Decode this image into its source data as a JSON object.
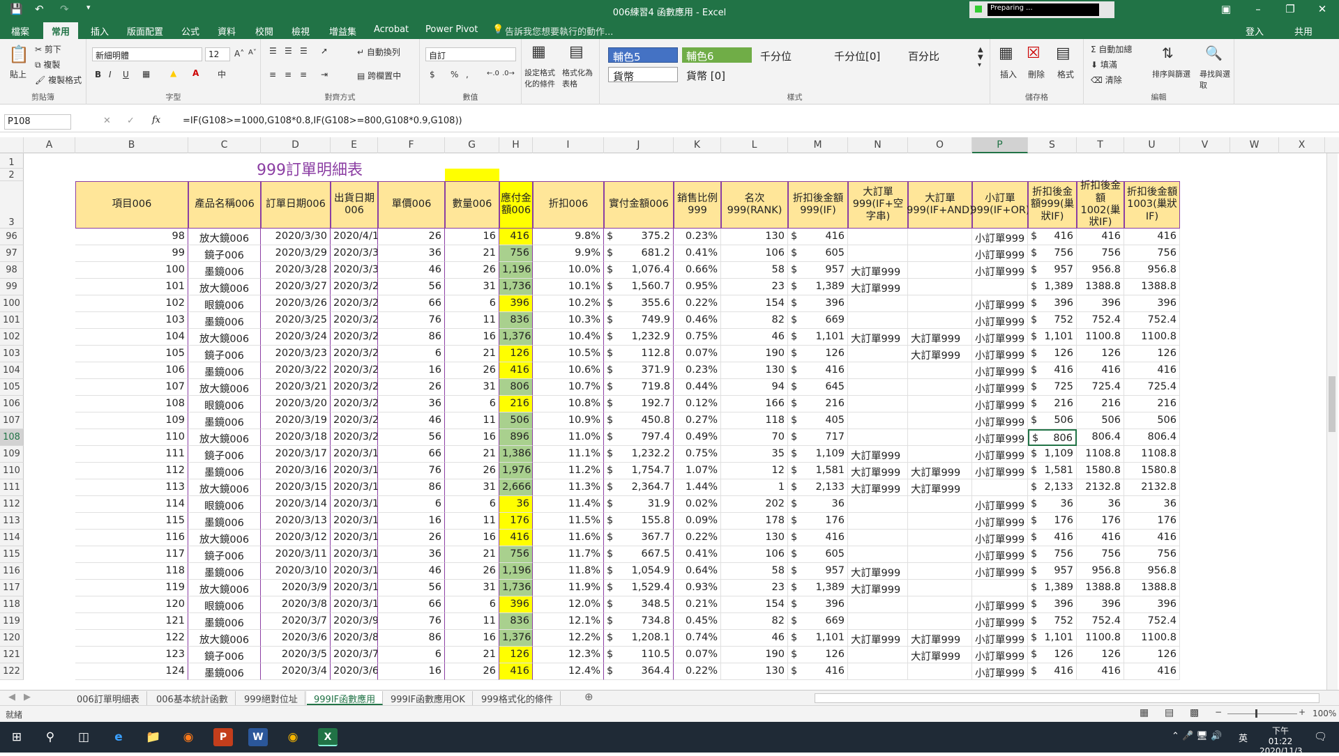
{
  "window_title": "006練習4 函數應用 - Excel",
  "preparing_text": "Preparing ...",
  "ribbon_tabs": [
    "檔案",
    "常用",
    "插入",
    "版面配置",
    "公式",
    "資料",
    "校閱",
    "檢視",
    "增益集",
    "Acrobat",
    "Power Pivot"
  ],
  "tell_me": "告訴我您想要執行的動作...",
  "signin": "登入",
  "share": "共用",
  "clipboard": {
    "paste": "貼上",
    "cut": "剪下",
    "copy": "複製",
    "format_painter": "複製格式",
    "label": "剪貼簿"
  },
  "font": {
    "name": "新細明體",
    "size": "12",
    "label": "字型",
    "bold": "B",
    "italic": "I",
    "underline": "U"
  },
  "alignment": {
    "wrap": "自動換列",
    "merge": "跨欄置中",
    "label": "對齊方式"
  },
  "number": {
    "format": "自訂",
    "label": "數值",
    "currency": "$",
    "percent": "%",
    "comma": ","
  },
  "conditional": {
    "cond_format": "設定格式化的條件",
    "format_table": "格式化為表格"
  },
  "styles": {
    "label": "樣式",
    "items": [
      "輔色5",
      "輔色6",
      "千分位",
      "千分位[0]",
      "百分比",
      "貨幣",
      "貨幣 [0]"
    ]
  },
  "cells": {
    "insert": "插入",
    "delete": "刪除",
    "format": "格式",
    "label": "儲存格"
  },
  "editing": {
    "autosum": "自動加總",
    "fill": "填滿",
    "clear": "清除",
    "sort": "排序與篩選",
    "find": "尋找與選取",
    "label": "編輯"
  },
  "name_box": "P108",
  "formula": "=IF(G108>=1000,G108*0.8,IF(G108>=800,G108*0.9,G108))",
  "columns": [
    "A",
    "B",
    "C",
    "D",
    "E",
    "F",
    "G",
    "H",
    "I",
    "J",
    "K",
    "L",
    "M",
    "N",
    "O",
    "P",
    "S",
    "T",
    "U",
    "V",
    "W",
    "X"
  ],
  "sheet_title": "999訂單明細表",
  "headers": [
    "項目006",
    "產品名稱006",
    "訂單日期006",
    "出貨日期006",
    "單價006",
    "數量006",
    "應付金額006",
    "折扣006",
    "實付金額006",
    "銷售比例999",
    "名次999(RANK)",
    "折扣後金額999(IF)",
    "大訂單999(IF+空字串)",
    "大訂單999(IF+AND)",
    "小訂單999(IF+OR)",
    "折扣後金額999(巢狀IF)",
    "折扣後金額1002(巢狀IF)",
    "折扣後金額1003(巢狀IF)"
  ],
  "rows": [
    [
      "96",
      "98",
      "放大鏡006",
      "2020/3/30",
      "2020/4/1",
      "26",
      "16",
      "416",
      "9.8%",
      "375.2",
      "0.23%",
      "130",
      "416",
      "",
      "",
      "小訂單999",
      "416",
      "416",
      "416"
    ],
    [
      "97",
      "99",
      "鏡子006",
      "2020/3/29",
      "2020/3/31",
      "36",
      "21",
      "756",
      "9.9%",
      "681.2",
      "0.41%",
      "106",
      "605",
      "",
      "",
      "小訂單999",
      "756",
      "756",
      "756"
    ],
    [
      "98",
      "100",
      "墨鏡006",
      "2020/3/28",
      "2020/3/30",
      "46",
      "26",
      "1,196",
      "10.0%",
      "1,076.4",
      "0.66%",
      "58",
      "957",
      "大訂單999",
      "",
      "小訂單999",
      "957",
      "956.8",
      "956.8"
    ],
    [
      "99",
      "101",
      "放大鏡006",
      "2020/3/27",
      "2020/3/29",
      "56",
      "31",
      "1,736",
      "10.1%",
      "1,560.7",
      "0.95%",
      "23",
      "1,389",
      "大訂單999",
      "",
      "",
      "1,389",
      "1388.8",
      "1388.8"
    ],
    [
      "100",
      "102",
      "眼鏡006",
      "2020/3/26",
      "2020/3/28",
      "66",
      "6",
      "396",
      "10.2%",
      "355.6",
      "0.22%",
      "154",
      "396",
      "",
      "",
      "小訂單999",
      "396",
      "396",
      "396"
    ],
    [
      "101",
      "103",
      "墨鏡006",
      "2020/3/25",
      "2020/3/27",
      "76",
      "11",
      "836",
      "10.3%",
      "749.9",
      "0.46%",
      "82",
      "669",
      "",
      "",
      "小訂單999",
      "752",
      "752.4",
      "752.4"
    ],
    [
      "102",
      "104",
      "放大鏡006",
      "2020/3/24",
      "2020/3/26",
      "86",
      "16",
      "1,376",
      "10.4%",
      "1,232.9",
      "0.75%",
      "46",
      "1,101",
      "大訂單999",
      "大訂單999",
      "小訂單999",
      "1,101",
      "1100.8",
      "1100.8"
    ],
    [
      "103",
      "105",
      "鏡子006",
      "2020/3/23",
      "2020/3/25",
      "6",
      "21",
      "126",
      "10.5%",
      "112.8",
      "0.07%",
      "190",
      "126",
      "",
      "大訂單999",
      "小訂單999",
      "126",
      "126",
      "126"
    ],
    [
      "104",
      "106",
      "墨鏡006",
      "2020/3/22",
      "2020/3/24",
      "16",
      "26",
      "416",
      "10.6%",
      "371.9",
      "0.23%",
      "130",
      "416",
      "",
      "",
      "小訂單999",
      "416",
      "416",
      "416"
    ],
    [
      "105",
      "107",
      "放大鏡006",
      "2020/3/21",
      "2020/3/23",
      "26",
      "31",
      "806",
      "10.7%",
      "719.8",
      "0.44%",
      "94",
      "645",
      "",
      "",
      "小訂單999",
      "725",
      "725.4",
      "725.4"
    ],
    [
      "106",
      "108",
      "眼鏡006",
      "2020/3/20",
      "2020/3/22",
      "36",
      "6",
      "216",
      "10.8%",
      "192.7",
      "0.12%",
      "166",
      "216",
      "",
      "",
      "小訂單999",
      "216",
      "216",
      "216"
    ],
    [
      "107",
      "109",
      "墨鏡006",
      "2020/3/19",
      "2020/3/21",
      "46",
      "11",
      "506",
      "10.9%",
      "450.8",
      "0.27%",
      "118",
      "405",
      "",
      "",
      "小訂單999",
      "506",
      "506",
      "506"
    ],
    [
      "108",
      "110",
      "放大鏡006",
      "2020/3/18",
      "2020/3/20",
      "56",
      "16",
      "896",
      "11.0%",
      "797.4",
      "0.49%",
      "70",
      "717",
      "",
      "",
      "小訂單999",
      "806",
      "806.4",
      "806.4"
    ],
    [
      "109",
      "111",
      "鏡子006",
      "2020/3/17",
      "2020/3/19",
      "66",
      "21",
      "1,386",
      "11.1%",
      "1,232.2",
      "0.75%",
      "35",
      "1,109",
      "大訂單999",
      "",
      "小訂單999",
      "1,109",
      "1108.8",
      "1108.8"
    ],
    [
      "110",
      "112",
      "墨鏡006",
      "2020/3/16",
      "2020/3/18",
      "76",
      "26",
      "1,976",
      "11.2%",
      "1,754.7",
      "1.07%",
      "12",
      "1,581",
      "大訂單999",
      "大訂單999",
      "小訂單999",
      "1,581",
      "1580.8",
      "1580.8"
    ],
    [
      "111",
      "113",
      "放大鏡006",
      "2020/3/15",
      "2020/3/17",
      "86",
      "31",
      "2,666",
      "11.3%",
      "2,364.7",
      "1.44%",
      "1",
      "2,133",
      "大訂單999",
      "大訂單999",
      "",
      "2,133",
      "2132.8",
      "2132.8"
    ],
    [
      "112",
      "114",
      "眼鏡006",
      "2020/3/14",
      "2020/3/16",
      "6",
      "6",
      "36",
      "11.4%",
      "31.9",
      "0.02%",
      "202",
      "36",
      "",
      "",
      "小訂單999",
      "36",
      "36",
      "36"
    ],
    [
      "113",
      "115",
      "墨鏡006",
      "2020/3/13",
      "2020/3/15",
      "16",
      "11",
      "176",
      "11.5%",
      "155.8",
      "0.09%",
      "178",
      "176",
      "",
      "",
      "小訂單999",
      "176",
      "176",
      "176"
    ],
    [
      "114",
      "116",
      "放大鏡006",
      "2020/3/12",
      "2020/3/14",
      "26",
      "16",
      "416",
      "11.6%",
      "367.7",
      "0.22%",
      "130",
      "416",
      "",
      "",
      "小訂單999",
      "416",
      "416",
      "416"
    ],
    [
      "115",
      "117",
      "鏡子006",
      "2020/3/11",
      "2020/3/13",
      "36",
      "21",
      "756",
      "11.7%",
      "667.5",
      "0.41%",
      "106",
      "605",
      "",
      "",
      "小訂單999",
      "756",
      "756",
      "756"
    ],
    [
      "116",
      "118",
      "墨鏡006",
      "2020/3/10",
      "2020/3/12",
      "46",
      "26",
      "1,196",
      "11.8%",
      "1,054.9",
      "0.64%",
      "58",
      "957",
      "大訂單999",
      "",
      "小訂單999",
      "957",
      "956.8",
      "956.8"
    ],
    [
      "117",
      "119",
      "放大鏡006",
      "2020/3/9",
      "2020/3/11",
      "56",
      "31",
      "1,736",
      "11.9%",
      "1,529.4",
      "0.93%",
      "23",
      "1,389",
      "大訂單999",
      "",
      "",
      "1,389",
      "1388.8",
      "1388.8"
    ],
    [
      "118",
      "120",
      "眼鏡006",
      "2020/3/8",
      "2020/3/10",
      "66",
      "6",
      "396",
      "12.0%",
      "348.5",
      "0.21%",
      "154",
      "396",
      "",
      "",
      "小訂單999",
      "396",
      "396",
      "396"
    ],
    [
      "119",
      "121",
      "墨鏡006",
      "2020/3/7",
      "2020/3/9",
      "76",
      "11",
      "836",
      "12.1%",
      "734.8",
      "0.45%",
      "82",
      "669",
      "",
      "",
      "小訂單999",
      "752",
      "752.4",
      "752.4"
    ],
    [
      "120",
      "122",
      "放大鏡006",
      "2020/3/6",
      "2020/3/8",
      "86",
      "16",
      "1,376",
      "12.2%",
      "1,208.1",
      "0.74%",
      "46",
      "1,101",
      "大訂單999",
      "大訂單999",
      "小訂單999",
      "1,101",
      "1100.8",
      "1100.8"
    ],
    [
      "121",
      "123",
      "鏡子006",
      "2020/3/5",
      "2020/3/7",
      "6",
      "21",
      "126",
      "12.3%",
      "110.5",
      "0.07%",
      "190",
      "126",
      "",
      "大訂單999",
      "小訂單999",
      "126",
      "126",
      "126"
    ],
    [
      "122",
      "124",
      "墨鏡006",
      "2020/3/4",
      "2020/3/6",
      "16",
      "26",
      "416",
      "12.4%",
      "364.4",
      "0.22%",
      "130",
      "416",
      "",
      "",
      "小訂單999",
      "416",
      "416",
      "416"
    ]
  ],
  "sheet_tabs": [
    "006訂單明細表",
    "006基本統計函數",
    "999絕對位址",
    "999IF函數應用",
    "999IF函數應用OK",
    "999格式化的條件"
  ],
  "active_sheet": "999IF函數應用",
  "status": "就緒",
  "zoom": "100%",
  "clock": {
    "time": "下午 01:22",
    "date": "2020/11/3"
  },
  "ime": "英",
  "colors": {
    "excel_green": "#217346",
    "yellow": "#ffff00",
    "green": "#a9d08e",
    "header": "#ffe699",
    "border": "#8b3ea3"
  }
}
